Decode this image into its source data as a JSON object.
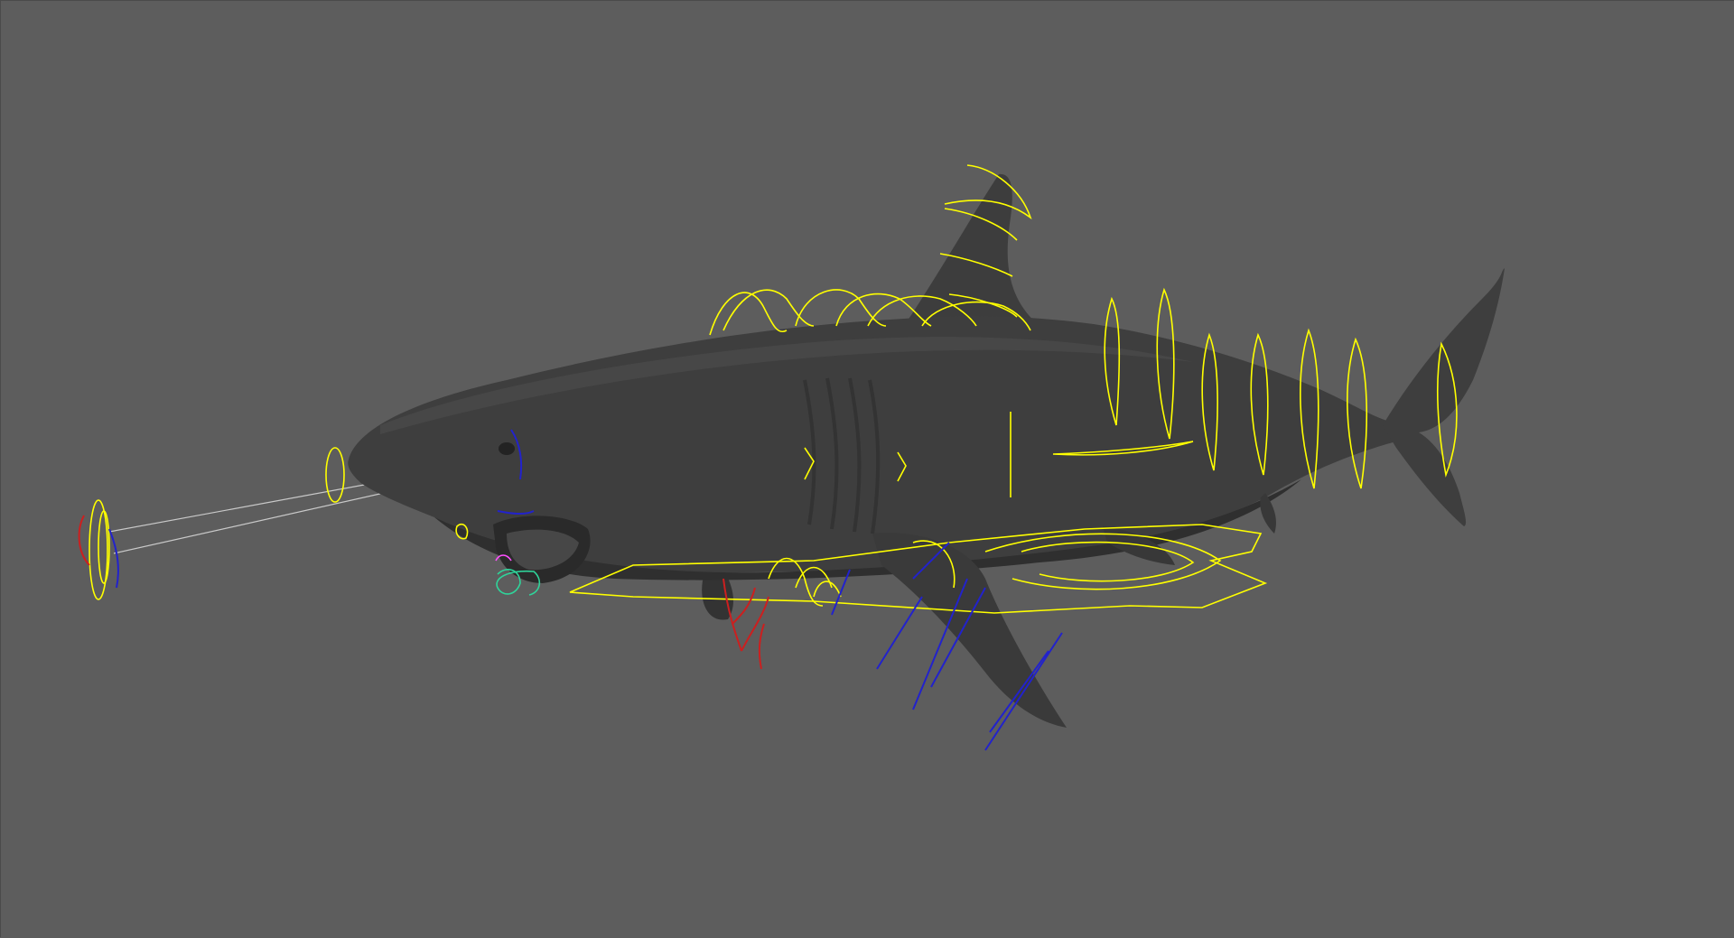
{
  "viewport": {
    "background_color": "#5d5d5d",
    "mesh_color": "#3d3d3d",
    "mesh_shadow_color": "#2c2c2c",
    "mesh_highlight_color": "#4c4c4c"
  },
  "model": {
    "icon": "shark-mesh-icon"
  },
  "rig_controls": {
    "primary_color": "#ffff00",
    "fk_color": "#2222cc",
    "ik_color": "#cc1f1f",
    "accent_colors": [
      "#2fd49a",
      "#ff4fff"
    ]
  }
}
